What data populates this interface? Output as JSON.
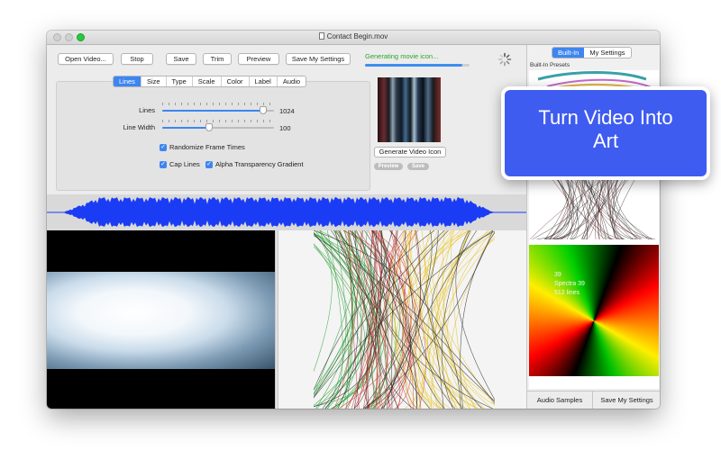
{
  "window": {
    "title": "Contact Begin.mov"
  },
  "toolbar": {
    "open_video": "Open Video...",
    "stop": "Stop",
    "save": "Save",
    "trim": "Trim",
    "preview": "Preview",
    "save_my_settings": "Save My Settings"
  },
  "progress": {
    "label": "Generating movie icon...",
    "fraction": 0.93
  },
  "tabs": [
    "Lines",
    "Size",
    "Type",
    "Scale",
    "Color",
    "Label",
    "Audio"
  ],
  "sliders": [
    {
      "label": "Lines",
      "value": "1024",
      "fraction": 0.9
    },
    {
      "label": "Line Width",
      "value": "100",
      "fraction": 0.42
    }
  ],
  "checks": {
    "randomize": "Randomize Frame Times",
    "cap_lines": "Cap Lines",
    "alpha": "Alpha Transparency Gradient"
  },
  "icon_panel": {
    "generate_button": "Generate Video Icon",
    "preview_pill": "Preview",
    "save_pill": "Save"
  },
  "sidebar": {
    "tab_builtin": "Built-In",
    "tab_my_settings": "My Settings",
    "presets_label": "Built-In Presets",
    "preset_text": [
      "39",
      "Spectra 39",
      "512 lines"
    ],
    "audio_samples": "Audio Samples",
    "save_my_settings": "Save My Settings"
  },
  "callout": {
    "line1": "Turn Video Into",
    "line2": "Art"
  },
  "colors": {
    "accent": "#3d86f1",
    "callout": "#3f5cf0",
    "waveform": "#1a3cf5",
    "progress_text": "#2aa52a"
  }
}
